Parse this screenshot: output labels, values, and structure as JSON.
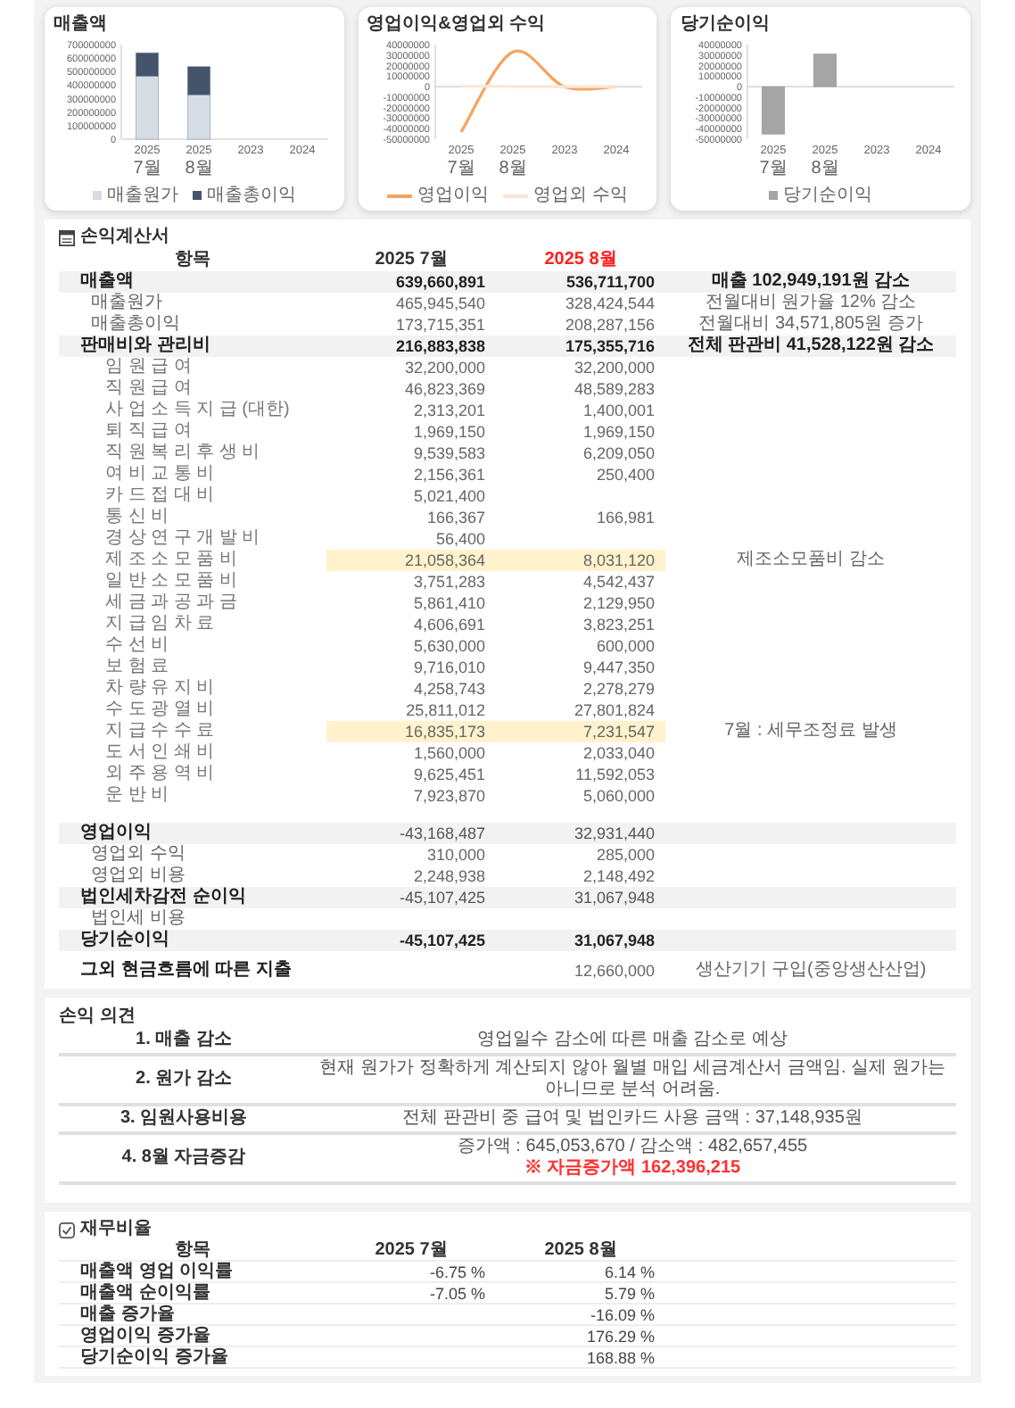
{
  "charts": [
    {
      "title": "매출액",
      "chart_data": {
        "type": "bar",
        "stacked": true,
        "categories": [
          "2025 7월",
          "2025 8월",
          "2023",
          "2024"
        ],
        "ylim": [
          0,
          700000000
        ],
        "yticks": [
          0,
          100000000,
          200000000,
          300000000,
          400000000,
          500000000,
          600000000,
          700000000
        ],
        "series": [
          {
            "name": "매출원가",
            "color": "#d6dce4",
            "values": [
              465945540,
              328424544,
              null,
              null
            ]
          },
          {
            "name": "매출총이익",
            "color": "#44546a",
            "values": [
              173715351,
              208287156,
              null,
              null
            ]
          }
        ]
      }
    },
    {
      "title": "영업이익&영업외 수익",
      "chart_data": {
        "type": "line",
        "categories": [
          "2025 7월",
          "2025 8월",
          "2023",
          "2024"
        ],
        "ylim": [
          -50000000,
          40000000
        ],
        "yticks": [
          -50000000,
          -40000000,
          -30000000,
          -20000000,
          -10000000,
          0,
          10000000,
          20000000,
          30000000,
          40000000
        ],
        "series": [
          {
            "name": "영업이익",
            "color": "#f4a460",
            "values": [
              -43168487,
              32931440,
              0,
              0
            ]
          },
          {
            "name": "영업외 수익",
            "color": "#fbe5d6",
            "values": [
              310000,
              285000,
              0,
              0
            ]
          }
        ]
      }
    },
    {
      "title": "당기순이익",
      "chart_data": {
        "type": "bar",
        "categories": [
          "2025 7월",
          "2025 8월",
          "2023",
          "2024"
        ],
        "ylim": [
          -50000000,
          40000000
        ],
        "yticks": [
          -50000000,
          -40000000,
          -30000000,
          -20000000,
          -10000000,
          0,
          10000000,
          20000000,
          30000000,
          40000000
        ],
        "series": [
          {
            "name": "당기순이익",
            "color": "#a5a5a5",
            "values": [
              -45107425,
              31067948,
              null,
              null
            ]
          }
        ]
      }
    }
  ],
  "income_statement": {
    "title": "손익계산서",
    "columns": [
      {
        "label": "항목",
        "emphasized": false
      },
      {
        "label": "2025 7월",
        "emphasized": false
      },
      {
        "label": "2025 8월",
        "emphasized": true
      }
    ],
    "sections": [
      {
        "rows": [
          {
            "kind": "total",
            "label": "매출액",
            "jul": "639,660,891",
            "aug": "536,711,700",
            "note": "매출 102,949,191원 감소",
            "highlighted": false
          },
          {
            "kind": "sub",
            "label": "매출원가",
            "jul": "465,945,540",
            "aug": "328,424,544",
            "note": "전월대비 원가율 12% 감소",
            "highlighted": false
          },
          {
            "kind": "sub",
            "label": "매출총이익",
            "jul": "173,715,351",
            "aug": "208,287,156",
            "note": "전월대비 34,571,805원 증가",
            "highlighted": false
          },
          {
            "kind": "total",
            "label": "판매비와 관리비",
            "jul": "216,883,838",
            "aug": "175,355,716",
            "note": "전체 판관비 41,528,122원 감소",
            "highlighted": false
          },
          {
            "kind": "item",
            "label": "임 원 급 여",
            "jul": "32,200,000",
            "aug": "32,200,000",
            "highlighted": false
          },
          {
            "kind": "item",
            "label": "직 원 급 여",
            "jul": "46,823,369",
            "aug": "48,589,283",
            "highlighted": false
          },
          {
            "kind": "item",
            "label": "사 업 소 득 지 급 (대한)",
            "jul": "2,313,201",
            "aug": "1,400,001",
            "highlighted": false
          },
          {
            "kind": "item",
            "label": "퇴 직 급 여",
            "jul": "1,969,150",
            "aug": "1,969,150",
            "highlighted": false
          },
          {
            "kind": "item",
            "label": "직 원 복 리 후 생 비",
            "jul": "9,539,583",
            "aug": "6,209,050",
            "highlighted": false
          },
          {
            "kind": "item",
            "label": "여 비 교 통 비",
            "jul": "2,156,361",
            "aug": "250,400",
            "highlighted": false
          },
          {
            "kind": "item",
            "label": "카 드 접 대 비",
            "jul": "5,021,400",
            "highlighted": false
          },
          {
            "kind": "item",
            "label": "통 신 비",
            "jul": "166,367",
            "aug": "166,981",
            "highlighted": false
          },
          {
            "kind": "item",
            "label": "경 상 연 구 개 발 비",
            "jul": "56,400",
            "highlighted": false
          },
          {
            "kind": "item",
            "label": "제 조 소 모 품 비",
            "jul": "21,058,364",
            "aug": "8,031,120",
            "note": "제조소모품비 감소",
            "highlighted": true
          },
          {
            "kind": "item",
            "label": "일 반 소 모 품 비",
            "jul": "3,751,283",
            "aug": "4,542,437",
            "highlighted": false
          },
          {
            "kind": "item",
            "label": "세 금 과 공 과 금",
            "jul": "5,861,410",
            "aug": "2,129,950",
            "highlighted": false
          },
          {
            "kind": "item",
            "label": "지 급 임 차 료",
            "jul": "4,606,691",
            "aug": "3,823,251",
            "highlighted": false
          },
          {
            "kind": "item",
            "label": "수 선 비",
            "jul": "5,630,000",
            "aug": "600,000",
            "highlighted": false
          },
          {
            "kind": "item",
            "label": "보 험 료",
            "jul": "9,716,010",
            "aug": "9,447,350",
            "highlighted": false
          },
          {
            "kind": "item",
            "label": "차 량 유 지 비",
            "jul": "4,258,743",
            "aug": "2,278,279",
            "highlighted": false
          },
          {
            "kind": "item",
            "label": "수 도 광 열 비",
            "jul": "25,811,012",
            "aug": "27,801,824",
            "highlighted": false
          },
          {
            "kind": "item",
            "label": "지 급 수 수 료",
            "jul": "16,835,173",
            "aug": "7,231,547",
            "note": "7월 : 세무조정료 발생",
            "highlighted": true
          },
          {
            "kind": "item",
            "label": "도 서 인 쇄 비",
            "jul": "1,560,000",
            "aug": "2,033,040",
            "highlighted": false
          },
          {
            "kind": "item",
            "label": "외 주 용 역 비",
            "jul": "9,625,451",
            "aug": "11,592,053",
            "highlighted": false
          },
          {
            "kind": "item",
            "label": "운 반 비",
            "jul": "7,923,870",
            "aug": "5,060,000",
            "highlighted": false
          }
        ]
      },
      {
        "rows": [
          {
            "kind": "subtotal",
            "label": "영업이익",
            "jul": "-43,168,487",
            "aug": "32,931,440",
            "highlighted": false
          },
          {
            "kind": "sub",
            "label": "영업외 수익",
            "jul": "310,000",
            "aug": "285,000",
            "highlighted": false
          },
          {
            "kind": "sub",
            "label": "영업외 비용",
            "jul": "2,248,938",
            "aug": "2,148,492",
            "highlighted": false
          },
          {
            "kind": "subtotal",
            "label": "법인세차감전 순이익",
            "jul": "-45,107,425",
            "aug": "31,067,948",
            "highlighted": false
          },
          {
            "kind": "sub",
            "label": "법인세 비용",
            "highlighted": false
          },
          {
            "kind": "total",
            "label": "당기순이익",
            "jul": "-45,107,425",
            "aug": "31,067,948",
            "highlighted": false
          },
          {
            "kind": "extra",
            "label": "그외 현금흐름에 따른 지출",
            "aug": "12,660,000",
            "note": "생산기기 구입(중앙생산산업)",
            "highlighted": false
          }
        ]
      }
    ]
  },
  "opinion": {
    "title": "손익 의견",
    "rows": [
      {
        "label": "1. 매출 감소",
        "lines": [
          {
            "kind": "normal",
            "text": "영업일수 감소에 따른 매출 감소로 예상"
          }
        ]
      },
      {
        "label": "2. 원가 감소",
        "lines": [
          {
            "kind": "normal",
            "text": "현재 원가가 정확하게 계산되지 않아 월별 매입 세금계산서 금액임. 실제 원가는 아니므로 분석 어려움."
          }
        ]
      },
      {
        "label": "3. 임원사용비용",
        "lines": [
          {
            "kind": "normal",
            "text": "전체 판관비 중 급여 및 법인카드 사용 금액 : 37,148,935원"
          }
        ]
      },
      {
        "label": "4. 8월 자금증감",
        "lines": [
          {
            "kind": "normal",
            "text": "증가액 : 645,053,670 / 감소액 : 482,657,455"
          },
          {
            "kind": "alert",
            "text": "※ 자금증가액 162,396,215"
          }
        ]
      }
    ]
  },
  "ratios": {
    "title": "재무비율",
    "columns": [
      "항목",
      "2025 7월",
      "2025 8월"
    ],
    "rows": [
      {
        "label": "매출액 영업 이익률",
        "jul": "-6.75 %",
        "aug": "6.14 %"
      },
      {
        "label": "매출액 순이익률",
        "jul": "-7.05 %",
        "aug": "5.79 %"
      },
      {
        "label": "매출 증가율",
        "aug": "-16.09 %"
      },
      {
        "label": "영업이익 증가율",
        "aug": "176.29 %"
      },
      {
        "label": "당기순이익 증가율",
        "aug": "168.88 %"
      }
    ]
  }
}
